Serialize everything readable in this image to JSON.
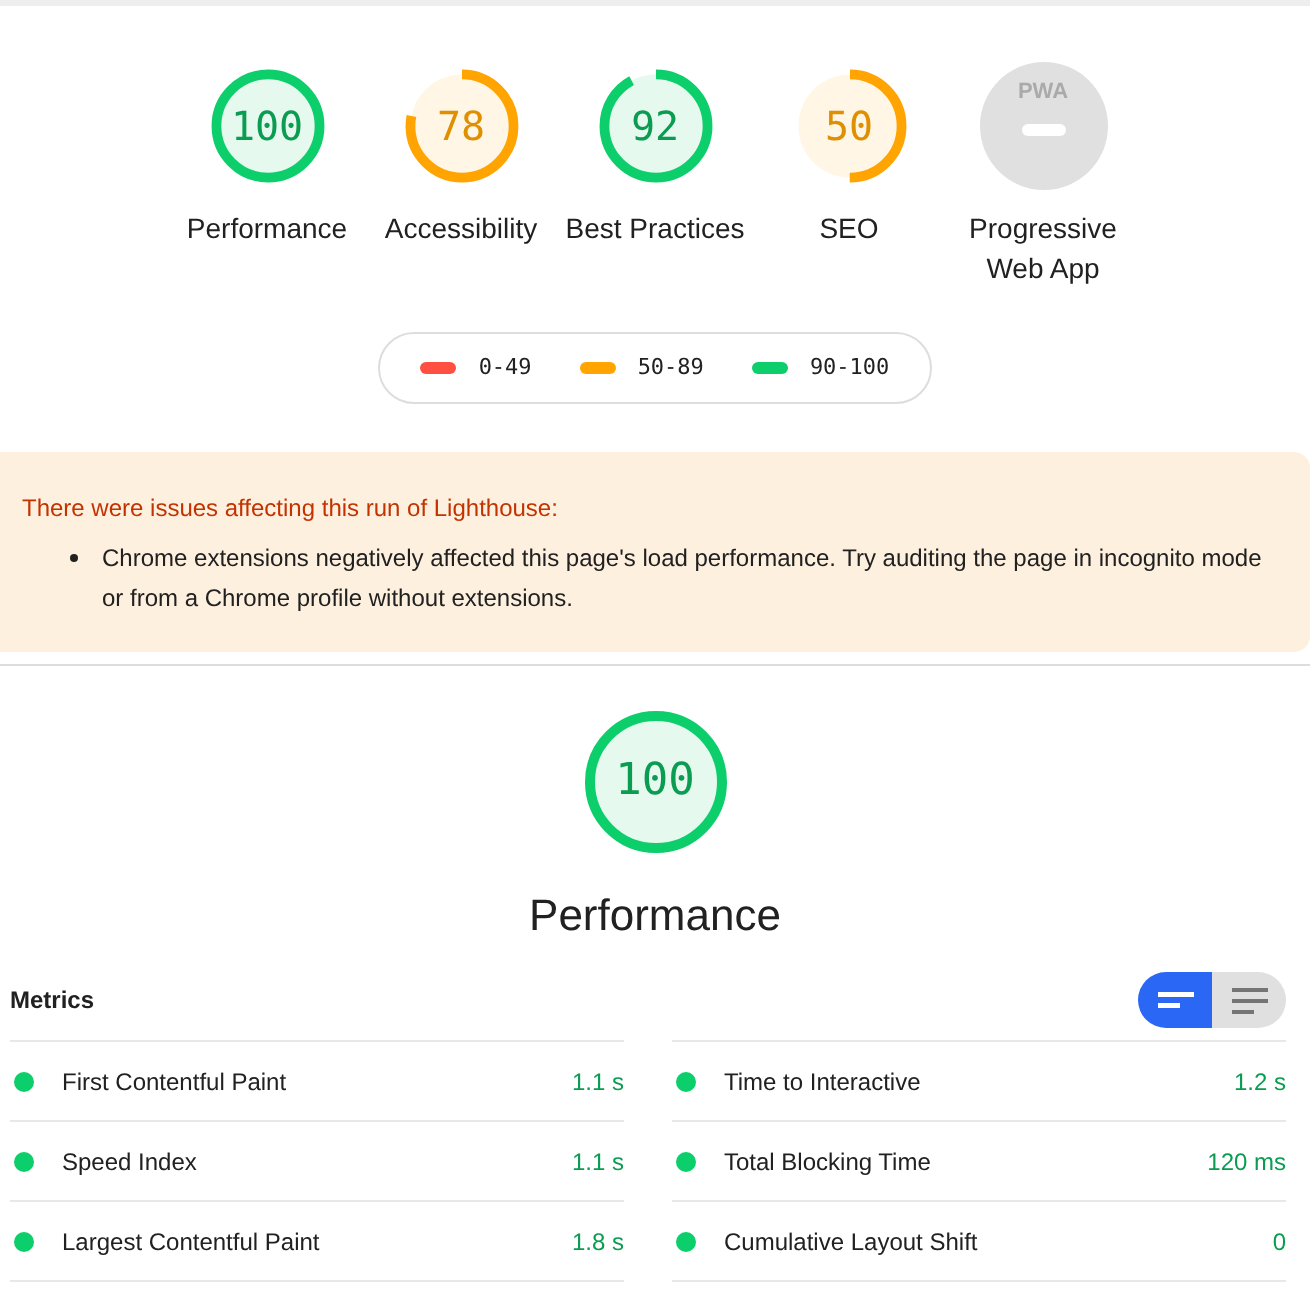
{
  "gauges": [
    {
      "kind": "score",
      "score": "100",
      "label": "Performance"
    },
    {
      "kind": "score",
      "score": "78",
      "label": "Accessibility"
    },
    {
      "kind": "score",
      "score": "92",
      "label": "Best Practices"
    },
    {
      "kind": "score",
      "score": "50",
      "label": "SEO"
    },
    {
      "kind": "pwa",
      "badge": "PWA",
      "label": "Progressive Web App"
    }
  ],
  "legend": [
    {
      "range": "0-49",
      "color": "#ff4e42"
    },
    {
      "range": "50-89",
      "color": "#ffa400"
    },
    {
      "range": "90-100",
      "color": "#0cce6b"
    }
  ],
  "warning": {
    "title": "There were issues affecting this run of Lighthouse:",
    "items": [
      "Chrome extensions negatively affected this page's load performance. Try auditing the page in incognito mode or from a Chrome profile without extensions."
    ]
  },
  "category": {
    "score": "100",
    "title": "Performance"
  },
  "metrics": {
    "title": "Metrics",
    "view_toggle": [
      {
        "kind": "compact",
        "selected": true
      },
      {
        "kind": "expanded",
        "selected": false
      }
    ],
    "items": [
      {
        "name": "First Contentful Paint",
        "value": "1.1 s",
        "color": "#0cce6b"
      },
      {
        "name": "Time to Interactive",
        "value": "1.2 s",
        "color": "#0cce6b"
      },
      {
        "name": "Speed Index",
        "value": "1.1 s",
        "color": "#0cce6b"
      },
      {
        "name": "Total Blocking Time",
        "value": "120 ms",
        "color": "#0cce6b"
      },
      {
        "name": "Largest Contentful Paint",
        "value": "1.8 s",
        "color": "#0cce6b"
      },
      {
        "name": "Cumulative Layout Shift",
        "value": "0",
        "color": "#0cce6b"
      }
    ]
  }
}
